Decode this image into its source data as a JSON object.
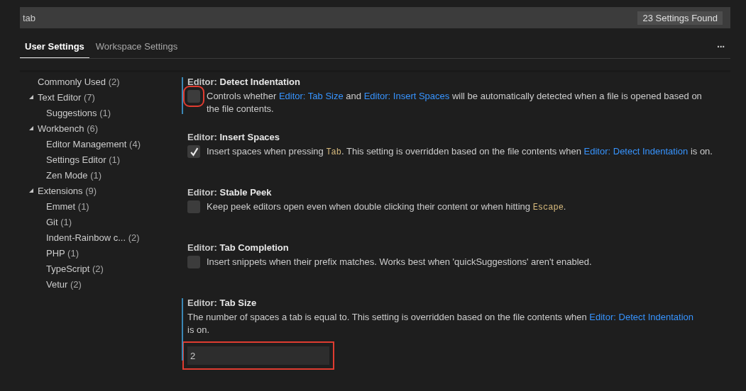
{
  "search": {
    "value": "tab",
    "result_count": "23 Settings Found"
  },
  "tabs": [
    {
      "label": "User Settings",
      "selected": true
    },
    {
      "label": "Workspace Settings",
      "selected": false
    }
  ],
  "more_button": "···",
  "toc": [
    {
      "label": "Commonly Used",
      "count": "(2)"
    },
    {
      "label": "Text Editor",
      "count": "(7)",
      "expanded": true,
      "children": [
        {
          "label": "Suggestions",
          "count": "(1)"
        }
      ]
    },
    {
      "label": "Workbench",
      "count": "(6)",
      "expanded": true,
      "children": [
        {
          "label": "Editor Management",
          "count": "(4)"
        },
        {
          "label": "Settings Editor",
          "count": "(1)"
        },
        {
          "label": "Zen Mode",
          "count": "(1)"
        }
      ]
    },
    {
      "label": "Extensions",
      "count": "(9)",
      "expanded": true,
      "children": [
        {
          "label": "Emmet",
          "count": "(1)"
        },
        {
          "label": "Git",
          "count": "(1)"
        },
        {
          "label": "Indent-Rainbow c...",
          "count": "(2)"
        },
        {
          "label": "PHP",
          "count": "(1)"
        },
        {
          "label": "TypeScript",
          "count": "(2)"
        },
        {
          "label": "Vetur",
          "count": "(2)"
        }
      ]
    }
  ],
  "settings": [
    {
      "kind": "checkbox",
      "category": "Editor:",
      "name": "Detect Indentation",
      "checked": false,
      "modified": true,
      "highlighted": true,
      "description": [
        {
          "text": "Controls whether "
        },
        {
          "link": "Editor: Tab Size"
        },
        {
          "text": " and "
        },
        {
          "link": "Editor: Insert Spaces"
        },
        {
          "text": " will be automatically detected when a file is opened based on the file contents."
        }
      ]
    },
    {
      "kind": "checkbox",
      "category": "Editor:",
      "name": "Insert Spaces",
      "checked": true,
      "modified": false,
      "highlighted": false,
      "description": [
        {
          "text": "Insert spaces when pressing "
        },
        {
          "code": "Tab"
        },
        {
          "text": ". This setting is overridden based on the file contents when "
        },
        {
          "link": "Editor: Detect Indentation"
        },
        {
          "text": " is on."
        }
      ]
    },
    {
      "kind": "checkbox",
      "category": "Editor:",
      "name": "Stable Peek",
      "checked": false,
      "modified": false,
      "highlighted": false,
      "description": [
        {
          "text": "Keep peek editors open even when double clicking their content or when hitting "
        },
        {
          "code": "Escape"
        },
        {
          "text": "."
        }
      ]
    },
    {
      "kind": "checkbox",
      "category": "Editor:",
      "name": "Tab Completion",
      "checked": false,
      "modified": false,
      "highlighted": false,
      "description": [
        {
          "text": "Insert snippets when their prefix matches. Works best when 'quickSuggestions' aren't enabled."
        }
      ]
    },
    {
      "kind": "number",
      "category": "Editor:",
      "name": "Tab Size",
      "value": "2",
      "modified": true,
      "highlighted": true,
      "description": [
        {
          "text": "The number of spaces a tab is equal to. This setting is overridden based on the file contents when "
        },
        {
          "link": "Editor: Detect Indentation"
        },
        {
          "text": " is on."
        }
      ]
    }
  ]
}
